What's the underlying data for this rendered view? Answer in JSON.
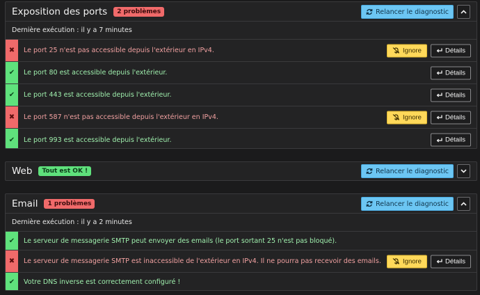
{
  "ports": {
    "title": "Exposition des ports",
    "badge": "2 problèmes",
    "rerun_label": "Relancer le diagnostic",
    "last_run": "Dernière exécution : il y a 7 minutes",
    "items": [
      {
        "status": "error",
        "message": "Le port 25 n'est pas accessible depuis l'extérieur en IPv4."
      },
      {
        "status": "ok",
        "message": "Le port 80 est accessible depuis l'extérieur."
      },
      {
        "status": "ok",
        "message": "Le port 443 est accessible depuis l'extérieur."
      },
      {
        "status": "error",
        "message": "Le port 587 n'est pas accessible depuis l'extérieur en IPv4."
      },
      {
        "status": "ok",
        "message": "Le port 993 est accessible depuis l'extérieur."
      }
    ]
  },
  "web": {
    "title": "Web",
    "badge": "Tout est OK !",
    "rerun_label": "Relancer le diagnostic"
  },
  "email": {
    "title": "Email",
    "badge": "1 problèmes",
    "rerun_label": "Relancer le diagnostic",
    "last_run": "Dernière exécution : il y a 2 minutes",
    "items": [
      {
        "status": "ok",
        "message": "Le serveur de messagerie SMTP peut envoyer des emails (le port sortant 25 n'est pas bloqué)."
      },
      {
        "status": "error",
        "message": "Le serveur de messagerie SMTP est inaccessible de l'extérieur en IPv4. Il ne pourra pas recevoir des emails."
      },
      {
        "status": "ok",
        "message": "Votre DNS inverse est correctement configuré !"
      }
    ]
  },
  "labels": {
    "ignore": "Ignore",
    "details": "Détails"
  },
  "icons": {
    "error": "times-icon",
    "ok": "check-icon",
    "rerun": "refresh-icon",
    "ignore": "bell-slash-icon",
    "details": "return-arrow-icon",
    "collapse": "chevron-up-icon",
    "expand": "chevron-down-icon"
  },
  "colors": {
    "error": "#f06a6a",
    "ok": "#5fe17c",
    "info": "#6cc6f3",
    "warning": "#ffd95a"
  }
}
